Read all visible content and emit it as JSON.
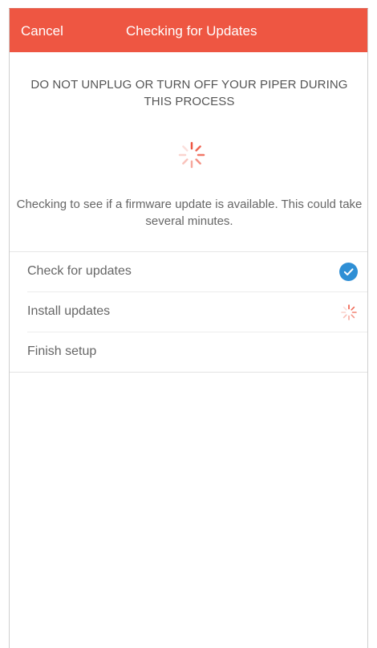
{
  "header": {
    "cancel_label": "Cancel",
    "title": "Checking for Updates",
    "color": "#ee5642"
  },
  "warning": "DO NOT UNPLUG OR TURN OFF YOUR PIPER DURING THIS PROCESS",
  "description": "Checking to see if a firmware update is available. This could take several minutes.",
  "steps": [
    {
      "label": "Check for updates",
      "status": "complete",
      "icon": "check-circle-icon"
    },
    {
      "label": "Install updates",
      "status": "in-progress",
      "icon": "loading-spinner-icon"
    },
    {
      "label": "Finish setup",
      "status": "pending"
    }
  ],
  "colors": {
    "accent": "#ee5642",
    "check": "#2f8fd5",
    "text": "#666666"
  }
}
